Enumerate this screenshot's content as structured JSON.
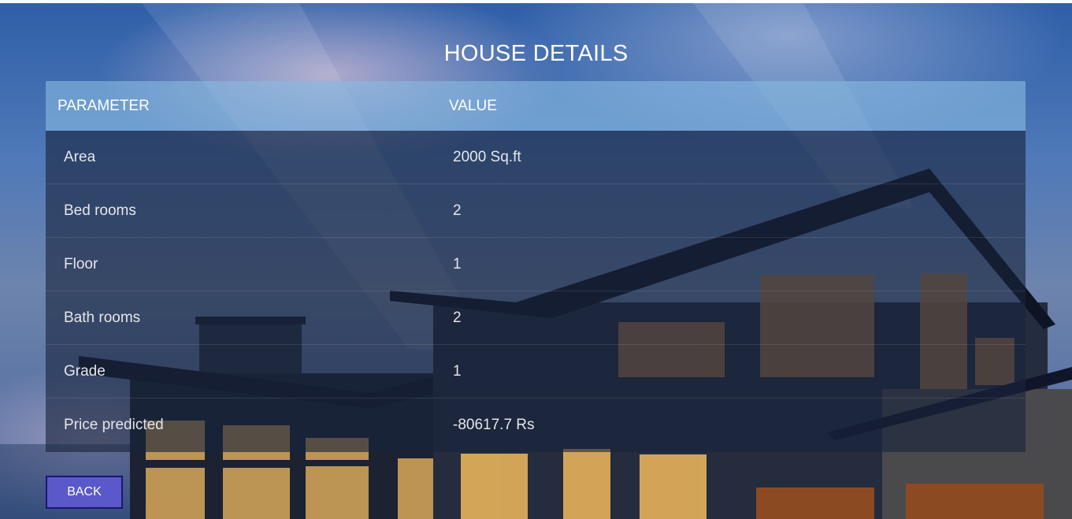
{
  "page": {
    "title": "HOUSE DETAILS"
  },
  "table": {
    "headers": {
      "parameter": "PARAMETER",
      "value": "VALUE"
    },
    "rows": [
      {
        "parameter": "Area",
        "value": "2000 Sq.ft"
      },
      {
        "parameter": "Bed rooms",
        "value": "2"
      },
      {
        "parameter": "Floor",
        "value": "1"
      },
      {
        "parameter": "Bath rooms",
        "value": "2"
      },
      {
        "parameter": "Grade",
        "value": "1"
      },
      {
        "parameter": "Price predicted",
        "value": "-80617.7 Rs"
      }
    ]
  },
  "actions": {
    "back_label": "BACK"
  },
  "colors": {
    "header_bg": "#87b9e1",
    "body_bg": "#19233c",
    "button_bg": "#5b59c9",
    "button_border": "#1b1576"
  }
}
